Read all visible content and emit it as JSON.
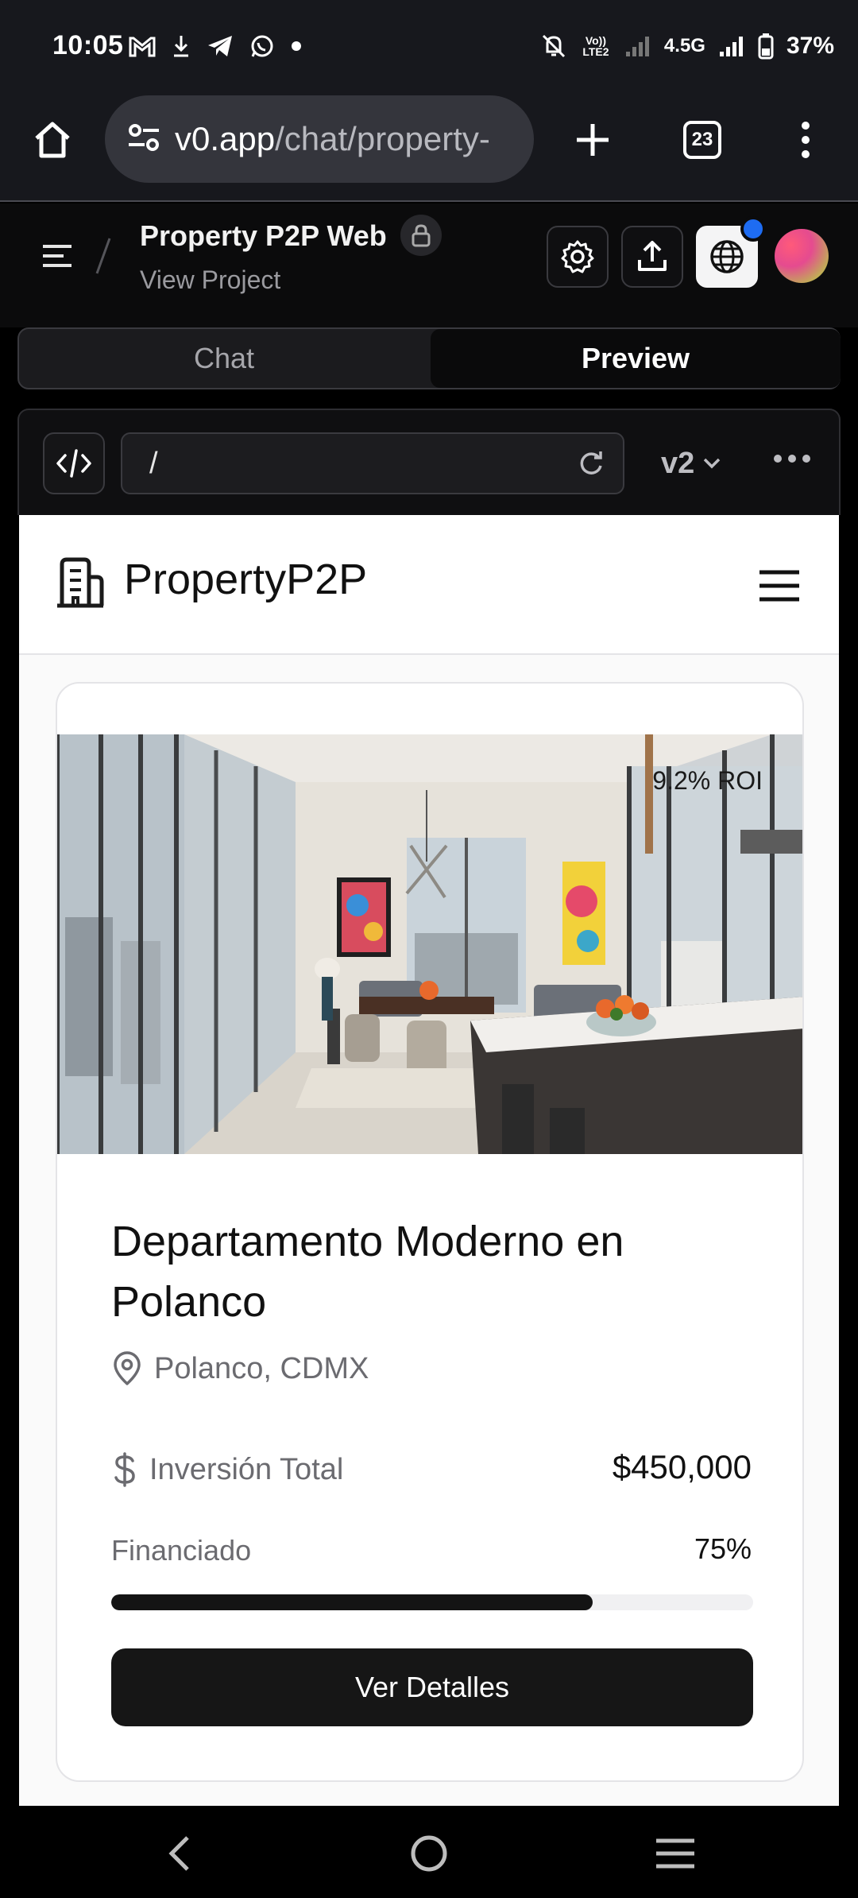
{
  "status_bar": {
    "time": "10:05",
    "network": "4.5G",
    "battery": "37%",
    "volte": "Vo)) LTE2"
  },
  "browser": {
    "url_domain": "v0.app",
    "url_path": "/chat/property-",
    "tab_count": "23"
  },
  "app_header": {
    "project_title": "Property P2P Web",
    "project_subtitle": "View Project"
  },
  "segment": {
    "chat_label": "Chat",
    "preview_label": "Preview",
    "active": "Preview"
  },
  "preview_toolbar": {
    "path_value": "/",
    "version": "v2"
  },
  "site": {
    "brand": "PropertyP2P"
  },
  "property_card": {
    "roi_badge": "9.2% ROI",
    "title": "Departamento Moderno en Polanco",
    "location": "Polanco, CDMX",
    "investment_label": "Inversión Total",
    "investment_value": "$450,000",
    "funded_label": "Financiado",
    "funded_value": "75%",
    "funded_fraction": 0.75,
    "cta_label": "Ver Detalles"
  },
  "colors": {
    "accent_blue": "#1e6cf2",
    "primary_dark": "#161616",
    "chrome_bg": "#17181d"
  }
}
